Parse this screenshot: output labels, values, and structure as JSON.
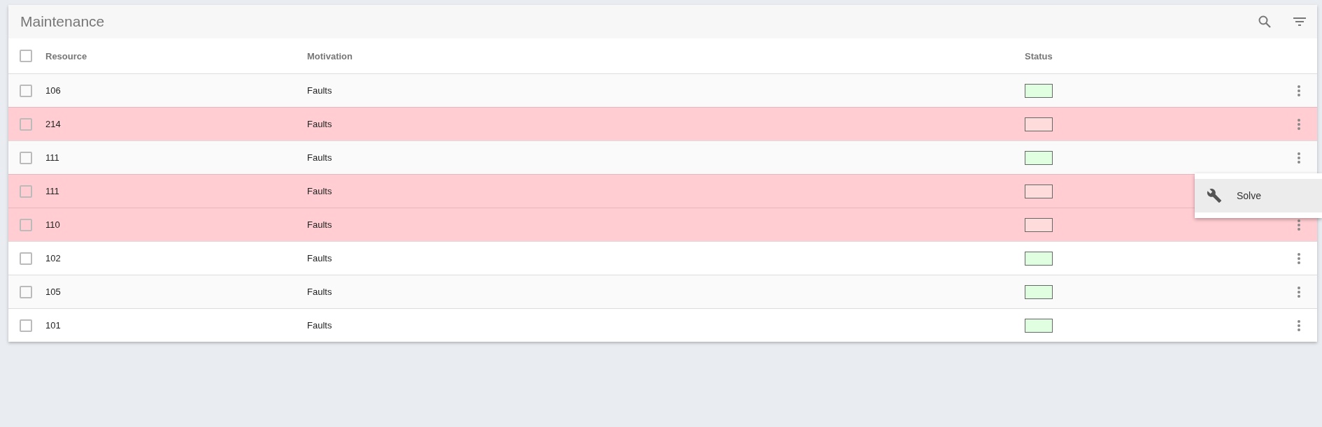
{
  "title": "Maintenance",
  "columns": [
    "Resource",
    "Motivation",
    "Status"
  ],
  "select_all": {
    "checked": false
  },
  "rows": [
    {
      "resource": "106",
      "motivation": "Faults",
      "color": "#e0ffe0",
      "highlighted": false,
      "checked": false
    },
    {
      "resource": "214",
      "motivation": "Faults",
      "color": "#ffdcdc",
      "highlighted": true,
      "checked": false
    },
    {
      "resource": "111",
      "motivation": "Faults",
      "color": "#e0ffe0",
      "highlighted": false,
      "checked": false
    },
    {
      "resource": "111",
      "motivation": "Faults",
      "color": "#ffdcdc",
      "highlighted": true,
      "checked": false,
      "covered_by_menu": true
    },
    {
      "resource": "110",
      "motivation": "Faults",
      "color": "#ffdcdc",
      "highlighted": true,
      "checked": false
    },
    {
      "resource": "102",
      "motivation": "Faults",
      "color": "#e0ffe0",
      "highlighted": false,
      "checked": false
    },
    {
      "resource": "105",
      "motivation": "Faults",
      "color": "#e0ffe0",
      "highlighted": false,
      "checked": false
    },
    {
      "resource": "101",
      "motivation": "Faults",
      "color": "#e0ffe0",
      "highlighted": false,
      "checked": false
    }
  ],
  "menu": {
    "items": [
      {
        "label": "Solve"
      }
    ]
  }
}
